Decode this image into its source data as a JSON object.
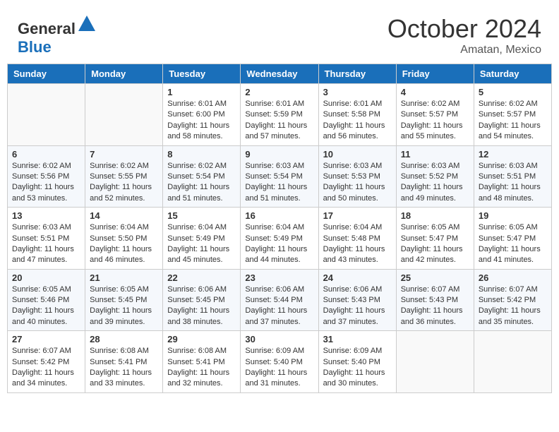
{
  "header": {
    "logo_general": "General",
    "logo_blue": "Blue",
    "month": "October 2024",
    "location": "Amatan, Mexico"
  },
  "weekdays": [
    "Sunday",
    "Monday",
    "Tuesday",
    "Wednesday",
    "Thursday",
    "Friday",
    "Saturday"
  ],
  "weeks": [
    [
      {
        "day": "",
        "sunrise": "",
        "sunset": "",
        "daylight": ""
      },
      {
        "day": "",
        "sunrise": "",
        "sunset": "",
        "daylight": ""
      },
      {
        "day": "1",
        "sunrise": "Sunrise: 6:01 AM",
        "sunset": "Sunset: 6:00 PM",
        "daylight": "Daylight: 11 hours and 58 minutes."
      },
      {
        "day": "2",
        "sunrise": "Sunrise: 6:01 AM",
        "sunset": "Sunset: 5:59 PM",
        "daylight": "Daylight: 11 hours and 57 minutes."
      },
      {
        "day": "3",
        "sunrise": "Sunrise: 6:01 AM",
        "sunset": "Sunset: 5:58 PM",
        "daylight": "Daylight: 11 hours and 56 minutes."
      },
      {
        "day": "4",
        "sunrise": "Sunrise: 6:02 AM",
        "sunset": "Sunset: 5:57 PM",
        "daylight": "Daylight: 11 hours and 55 minutes."
      },
      {
        "day": "5",
        "sunrise": "Sunrise: 6:02 AM",
        "sunset": "Sunset: 5:57 PM",
        "daylight": "Daylight: 11 hours and 54 minutes."
      }
    ],
    [
      {
        "day": "6",
        "sunrise": "Sunrise: 6:02 AM",
        "sunset": "Sunset: 5:56 PM",
        "daylight": "Daylight: 11 hours and 53 minutes."
      },
      {
        "day": "7",
        "sunrise": "Sunrise: 6:02 AM",
        "sunset": "Sunset: 5:55 PM",
        "daylight": "Daylight: 11 hours and 52 minutes."
      },
      {
        "day": "8",
        "sunrise": "Sunrise: 6:02 AM",
        "sunset": "Sunset: 5:54 PM",
        "daylight": "Daylight: 11 hours and 51 minutes."
      },
      {
        "day": "9",
        "sunrise": "Sunrise: 6:03 AM",
        "sunset": "Sunset: 5:54 PM",
        "daylight": "Daylight: 11 hours and 51 minutes."
      },
      {
        "day": "10",
        "sunrise": "Sunrise: 6:03 AM",
        "sunset": "Sunset: 5:53 PM",
        "daylight": "Daylight: 11 hours and 50 minutes."
      },
      {
        "day": "11",
        "sunrise": "Sunrise: 6:03 AM",
        "sunset": "Sunset: 5:52 PM",
        "daylight": "Daylight: 11 hours and 49 minutes."
      },
      {
        "day": "12",
        "sunrise": "Sunrise: 6:03 AM",
        "sunset": "Sunset: 5:51 PM",
        "daylight": "Daylight: 11 hours and 48 minutes."
      }
    ],
    [
      {
        "day": "13",
        "sunrise": "Sunrise: 6:03 AM",
        "sunset": "Sunset: 5:51 PM",
        "daylight": "Daylight: 11 hours and 47 minutes."
      },
      {
        "day": "14",
        "sunrise": "Sunrise: 6:04 AM",
        "sunset": "Sunset: 5:50 PM",
        "daylight": "Daylight: 11 hours and 46 minutes."
      },
      {
        "day": "15",
        "sunrise": "Sunrise: 6:04 AM",
        "sunset": "Sunset: 5:49 PM",
        "daylight": "Daylight: 11 hours and 45 minutes."
      },
      {
        "day": "16",
        "sunrise": "Sunrise: 6:04 AM",
        "sunset": "Sunset: 5:49 PM",
        "daylight": "Daylight: 11 hours and 44 minutes."
      },
      {
        "day": "17",
        "sunrise": "Sunrise: 6:04 AM",
        "sunset": "Sunset: 5:48 PM",
        "daylight": "Daylight: 11 hours and 43 minutes."
      },
      {
        "day": "18",
        "sunrise": "Sunrise: 6:05 AM",
        "sunset": "Sunset: 5:47 PM",
        "daylight": "Daylight: 11 hours and 42 minutes."
      },
      {
        "day": "19",
        "sunrise": "Sunrise: 6:05 AM",
        "sunset": "Sunset: 5:47 PM",
        "daylight": "Daylight: 11 hours and 41 minutes."
      }
    ],
    [
      {
        "day": "20",
        "sunrise": "Sunrise: 6:05 AM",
        "sunset": "Sunset: 5:46 PM",
        "daylight": "Daylight: 11 hours and 40 minutes."
      },
      {
        "day": "21",
        "sunrise": "Sunrise: 6:05 AM",
        "sunset": "Sunset: 5:45 PM",
        "daylight": "Daylight: 11 hours and 39 minutes."
      },
      {
        "day": "22",
        "sunrise": "Sunrise: 6:06 AM",
        "sunset": "Sunset: 5:45 PM",
        "daylight": "Daylight: 11 hours and 38 minutes."
      },
      {
        "day": "23",
        "sunrise": "Sunrise: 6:06 AM",
        "sunset": "Sunset: 5:44 PM",
        "daylight": "Daylight: 11 hours and 37 minutes."
      },
      {
        "day": "24",
        "sunrise": "Sunrise: 6:06 AM",
        "sunset": "Sunset: 5:43 PM",
        "daylight": "Daylight: 11 hours and 37 minutes."
      },
      {
        "day": "25",
        "sunrise": "Sunrise: 6:07 AM",
        "sunset": "Sunset: 5:43 PM",
        "daylight": "Daylight: 11 hours and 36 minutes."
      },
      {
        "day": "26",
        "sunrise": "Sunrise: 6:07 AM",
        "sunset": "Sunset: 5:42 PM",
        "daylight": "Daylight: 11 hours and 35 minutes."
      }
    ],
    [
      {
        "day": "27",
        "sunrise": "Sunrise: 6:07 AM",
        "sunset": "Sunset: 5:42 PM",
        "daylight": "Daylight: 11 hours and 34 minutes."
      },
      {
        "day": "28",
        "sunrise": "Sunrise: 6:08 AM",
        "sunset": "Sunset: 5:41 PM",
        "daylight": "Daylight: 11 hours and 33 minutes."
      },
      {
        "day": "29",
        "sunrise": "Sunrise: 6:08 AM",
        "sunset": "Sunset: 5:41 PM",
        "daylight": "Daylight: 11 hours and 32 minutes."
      },
      {
        "day": "30",
        "sunrise": "Sunrise: 6:09 AM",
        "sunset": "Sunset: 5:40 PM",
        "daylight": "Daylight: 11 hours and 31 minutes."
      },
      {
        "day": "31",
        "sunrise": "Sunrise: 6:09 AM",
        "sunset": "Sunset: 5:40 PM",
        "daylight": "Daylight: 11 hours and 30 minutes."
      },
      {
        "day": "",
        "sunrise": "",
        "sunset": "",
        "daylight": ""
      },
      {
        "day": "",
        "sunrise": "",
        "sunset": "",
        "daylight": ""
      }
    ]
  ]
}
